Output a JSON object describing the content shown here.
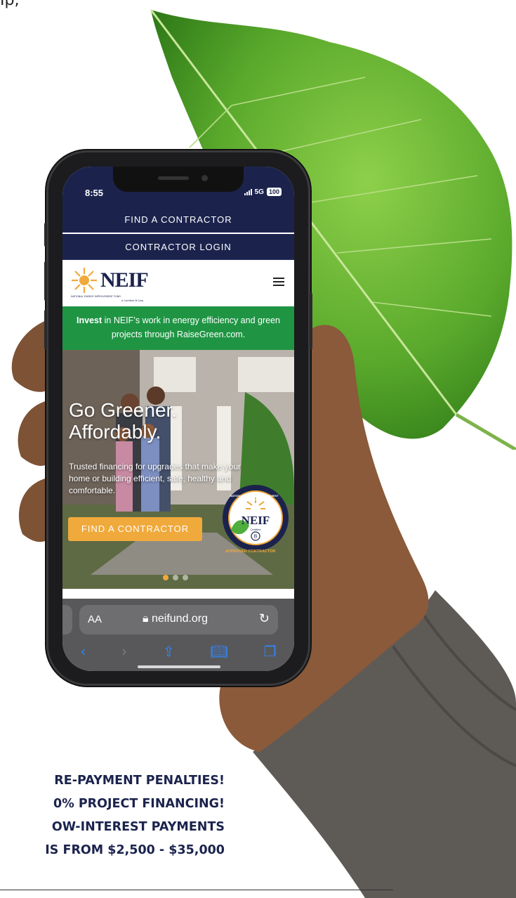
{
  "fragment": {
    "text": "Ip,"
  },
  "phone": {
    "status": {
      "time": "8:55",
      "network": "5G",
      "battery": "100"
    },
    "nav": {
      "find_contractor": "FIND A CONTRACTOR",
      "contractor_login": "CONTRACTOR LOGIN"
    },
    "header": {
      "logo_text": "NEIF",
      "logo_subtext": "NATIONAL ENERGY IMPROVEMENT FUND",
      "logo_tagline": "A Certified B Corp"
    },
    "banner": {
      "bold": "Invest",
      "text": " in NEIF’s work in energy efficiency and green projects through RaiseGreen.com."
    },
    "hero": {
      "title_line1": "Go Greener.",
      "title_line2": "Affordably.",
      "subtitle": "Trusted financing for upgrades that make your home or building efficient, safe, healthy and comfortable.",
      "cta": "FIND A CONTRACTOR",
      "seal_ring_text": "NATIONAL ENERGY IMPROVEMENT FUND",
      "seal_center": "NEIF",
      "seal_certified": "Certified",
      "seal_label": "APPROVED CONTRACTOR",
      "slide_count": 3,
      "active_slide": 1
    },
    "browser": {
      "text_size_label": "AA",
      "url": "neifund.org"
    }
  },
  "promo": {
    "line1": "RE-PAYMENT PENALTIES!",
    "line2": "0% PROJECT FINANCING!",
    "line3": "OW-INTEREST PAYMENTS",
    "line4": "IS FROM $2,500 - $35,000"
  },
  "colors": {
    "navy": "#1b234d",
    "green": "#1f9544",
    "orange": "#f0a93b",
    "browser_gray": "#58585a",
    "link_blue": "#2f87ff"
  }
}
